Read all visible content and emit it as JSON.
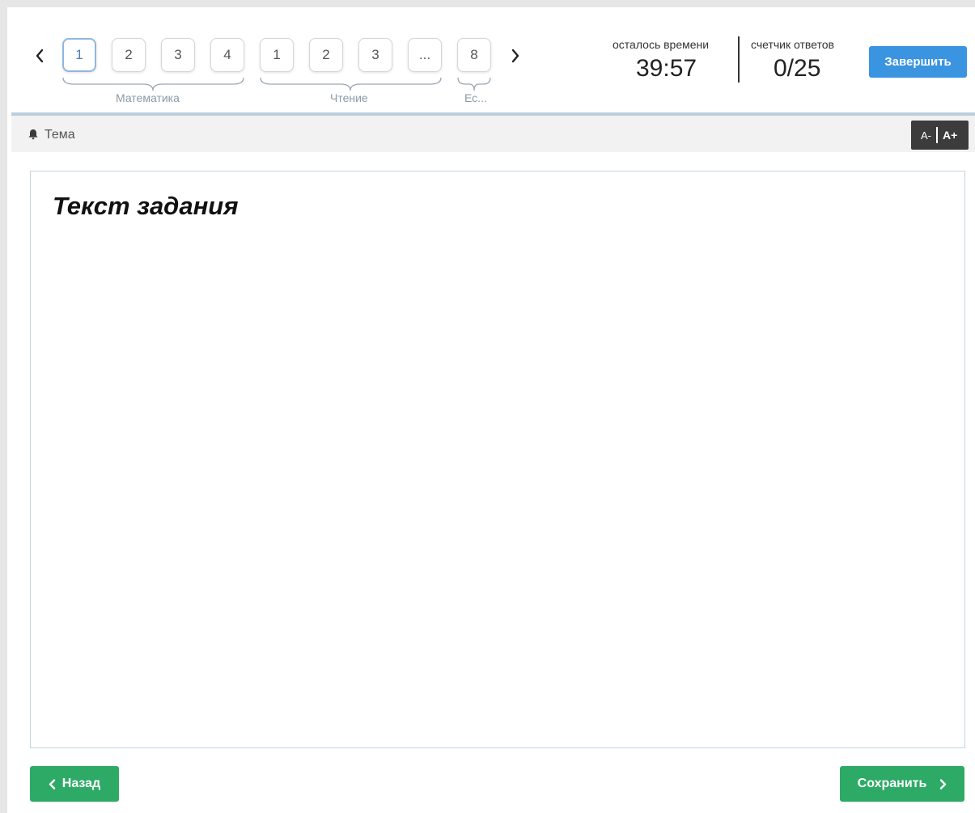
{
  "navigation": {
    "prev_icon": "chevron-left-icon",
    "next_icon": "chevron-right-icon",
    "questions": [
      {
        "label": "1",
        "active": true
      },
      {
        "label": "2",
        "active": false
      },
      {
        "label": "3",
        "active": false
      },
      {
        "label": "4",
        "active": false
      },
      {
        "label": "1",
        "active": false
      },
      {
        "label": "2",
        "active": false
      },
      {
        "label": "3",
        "active": false
      },
      {
        "label": "...",
        "active": false
      },
      {
        "label": "8",
        "active": false
      }
    ],
    "groups": [
      {
        "label": "Математика"
      },
      {
        "label": "Чтение"
      },
      {
        "label": "Ес..."
      }
    ]
  },
  "stats": {
    "time_label": "осталось времени",
    "time_value": "39:57",
    "answers_label": "счетчик ответов",
    "answers_value": "0/25"
  },
  "finish_button": {
    "label": "Завершить"
  },
  "topic": {
    "icon": "bell-icon",
    "label": "Тема"
  },
  "font_controls": {
    "decrease": "A-",
    "increase": "A+"
  },
  "task": {
    "text": "Текст задания"
  },
  "footer": {
    "back_label": "Назад",
    "back_icon": "chevron-left-icon",
    "save_label": "Сохранить",
    "save_icon": "chevron-right-icon"
  },
  "colors": {
    "accent_blue": "#3a94e0",
    "success_green": "#2dab66",
    "active_border": "#8fb7e0",
    "header_divider": "#b9cfe0",
    "topic_bar_bg": "#f2f2f2",
    "font_control_bg": "#3c3c3c"
  }
}
